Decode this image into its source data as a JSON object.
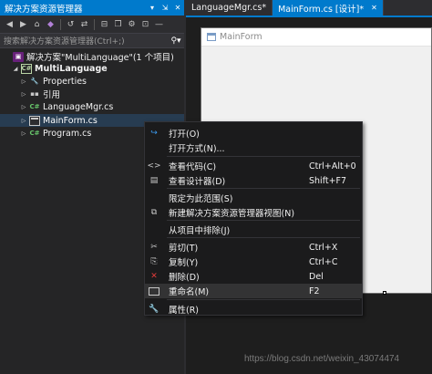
{
  "solution_explorer": {
    "title": "解决方案资源管理器",
    "title_buttons": [
      "▾",
      "⇲",
      "✕"
    ],
    "toolbar_icons": [
      "back-icon",
      "forward-icon",
      "home-icon",
      "vs-icon",
      "history-icon",
      "sync-icon",
      "collapse-icon",
      "show-all-files-icon",
      "properties-icon",
      "preview-icon",
      "dash-icon"
    ],
    "search_placeholder": "搜索解决方案资源管理器(Ctrl+;)",
    "tree": [
      {
        "label": "解决方案\"MultiLanguage\"(1 个项目)",
        "icon": "solution-icon",
        "indent": 0,
        "arrow": "",
        "bold": false
      },
      {
        "label": "MultiLanguage",
        "icon": "csharp-project-icon",
        "indent": 1,
        "arrow": "◢",
        "bold": true
      },
      {
        "label": "Properties",
        "icon": "wrench-icon",
        "indent": 2,
        "arrow": "▷",
        "bold": false
      },
      {
        "label": "引用",
        "icon": "references-icon",
        "indent": 2,
        "arrow": "▷",
        "bold": false
      },
      {
        "label": "LanguageMgr.cs",
        "icon": "csharp-file-icon",
        "indent": 2,
        "arrow": "▷",
        "bold": false
      },
      {
        "label": "MainForm.cs",
        "icon": "form-file-icon",
        "indent": 2,
        "arrow": "▷",
        "bold": false,
        "selected": true
      },
      {
        "label": "Program.cs",
        "icon": "csharp-file-icon",
        "indent": 2,
        "arrow": "▷",
        "bold": false
      }
    ]
  },
  "editor": {
    "tabs": [
      {
        "label": "LanguageMgr.cs*",
        "active": false
      },
      {
        "label": "MainForm.cs [设计]*",
        "active": true,
        "close": "✕"
      }
    ],
    "form_title": "MainForm"
  },
  "context_menu": {
    "items": [
      {
        "label": "打开(O)",
        "shortcut": "",
        "icon": "open-icon"
      },
      {
        "label": "打开方式(N)...",
        "shortcut": "",
        "icon": ""
      },
      {
        "label": "查看代码(C)",
        "shortcut": "Ctrl+Alt+0",
        "icon": "view-code-icon"
      },
      {
        "label": "查看设计器(D)",
        "shortcut": "Shift+F7",
        "icon": "view-designer-icon"
      },
      {
        "label": "限定为此范围(S)",
        "shortcut": "",
        "icon": ""
      },
      {
        "label": "新建解决方案资源管理器视图(N)",
        "shortcut": "",
        "icon": "new-view-icon"
      },
      {
        "label": "从项目中排除(J)",
        "shortcut": "",
        "icon": ""
      },
      {
        "label": "剪切(T)",
        "shortcut": "Ctrl+X",
        "icon": "cut-icon"
      },
      {
        "label": "复制(Y)",
        "shortcut": "Ctrl+C",
        "icon": "copy-icon"
      },
      {
        "label": "删除(D)",
        "shortcut": "Del",
        "icon": "delete-icon"
      },
      {
        "label": "重命名(M)",
        "shortcut": "F2",
        "icon": "rename-icon",
        "highlighted": true
      },
      {
        "label": "属性(R)",
        "shortcut": "",
        "icon": "properties-icon"
      }
    ]
  },
  "watermark": "https://blog.csdn.net/weixin_43074474"
}
